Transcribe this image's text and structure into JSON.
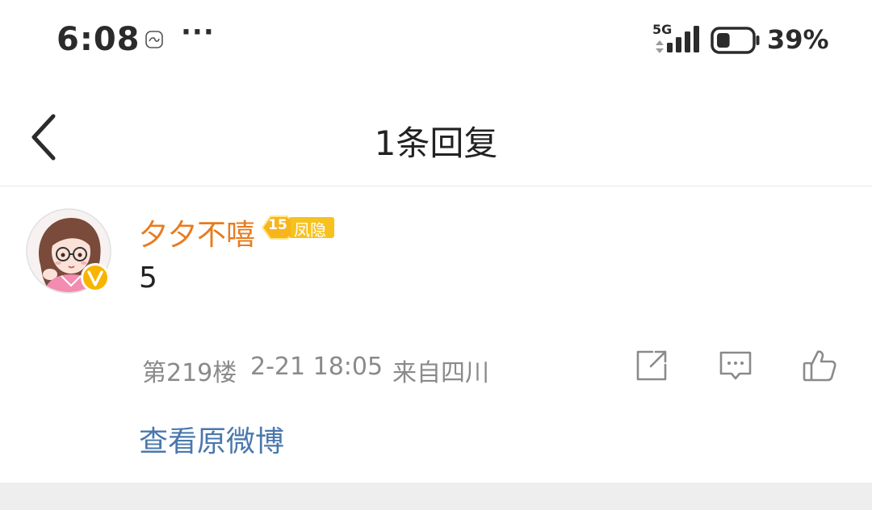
{
  "status_bar": {
    "time": "6:08",
    "more": "···",
    "network": "5G",
    "battery_level": 39,
    "battery_text": "39%"
  },
  "header": {
    "title": "1条回复",
    "back_icon": "chevron-left-icon"
  },
  "comment": {
    "username": "夕夕不嘻",
    "username_color": "#e87b1e",
    "level_number": "15",
    "level_label": "凤隐",
    "badge_color": "#f7c21d",
    "text": "5",
    "floor": "第219楼",
    "time": "2-21 18:05",
    "location": "来自四川",
    "actions": [
      "share-icon",
      "comment-icon",
      "like-icon"
    ]
  },
  "footer": {
    "view_original": "查看原微博",
    "link_color": "#4a78ad"
  }
}
